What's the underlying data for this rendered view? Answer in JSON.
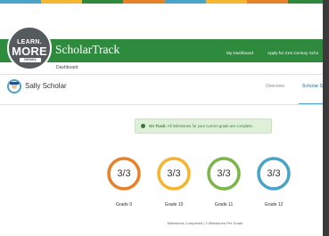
{
  "stripe_colors": [
    "#4aa3c8",
    "#f5b52e",
    "#2e8b3e",
    "#e8822a",
    "#4aa3c8",
    "#f5b52e",
    "#e8822a",
    "#2e8b3e"
  ],
  "header": {
    "logo_top": "LEARN.",
    "logo_main": "MORE",
    "logo_bottom": "INDIANA",
    "brand": "ScholarTrack",
    "nav": [
      "My Dashboard",
      "Apply for 21st Century Scho"
    ],
    "subnav": "Dashboard",
    "bg_color": "#2e8b3e"
  },
  "student": {
    "name": "Sally Scholar",
    "tabs": [
      {
        "label": "Overview",
        "active": false
      },
      {
        "label": "Scholar S",
        "active": true
      }
    ]
  },
  "status": {
    "bold": "On Track:",
    "text": "All milestones for your current grade are complete."
  },
  "grades": [
    {
      "value": "3/3",
      "label": "Grade 9",
      "color": "#e8822a",
      "progress": 1.0
    },
    {
      "value": "3/3",
      "label": "Grade 10",
      "color": "#f5b52e",
      "progress": 1.0
    },
    {
      "value": "3/3",
      "label": "Grade 11",
      "color": "#7ab648",
      "progress": 1.0
    },
    {
      "value": "3/3",
      "label": "Grade 12",
      "color": "#4aa3c8",
      "progress": 1.0
    }
  ],
  "footnote": "Milestones Completed | 3 Milestones Per Grade"
}
